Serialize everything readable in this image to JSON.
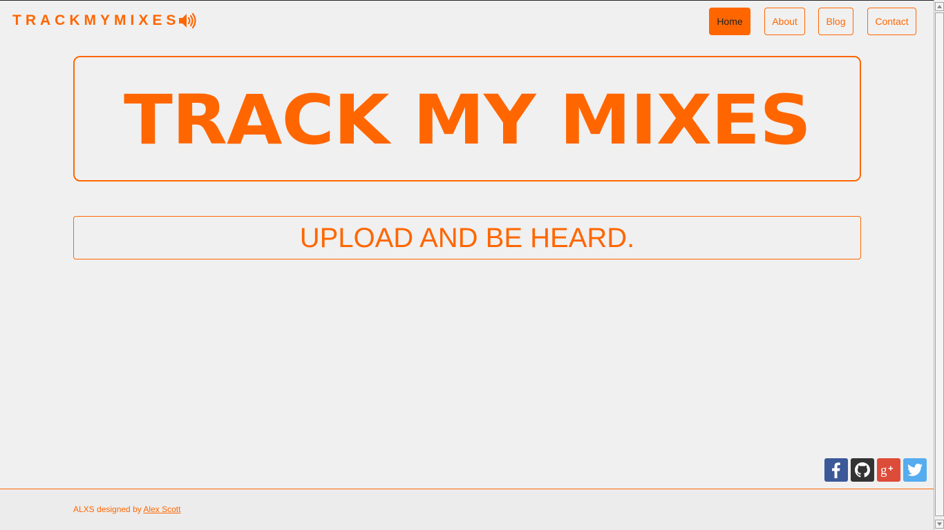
{
  "header": {
    "logo_text": "TRACKMYMIXES",
    "logo_icon": "speaker-volume-icon"
  },
  "nav": {
    "items": [
      {
        "label": "Home",
        "active": true
      },
      {
        "label": "About",
        "active": false
      },
      {
        "label": "Blog",
        "active": false
      },
      {
        "label": "Contact",
        "active": false
      }
    ]
  },
  "hero": {
    "title": "TRACK MY MIXES"
  },
  "tagline": {
    "text": "UPLOAD AND BE HEARD."
  },
  "social": {
    "icons": [
      "facebook-icon",
      "github-icon",
      "google-plus-icon",
      "twitter-icon"
    ]
  },
  "footer": {
    "prefix": "ALXS designed by ",
    "author_link": "Alex Scott"
  },
  "colors": {
    "accent": "#ff6600",
    "background": "#f0f0f0",
    "facebook": "#3b5998",
    "github": "#333333",
    "google_plus": "#dd4b39",
    "twitter": "#55acee"
  }
}
